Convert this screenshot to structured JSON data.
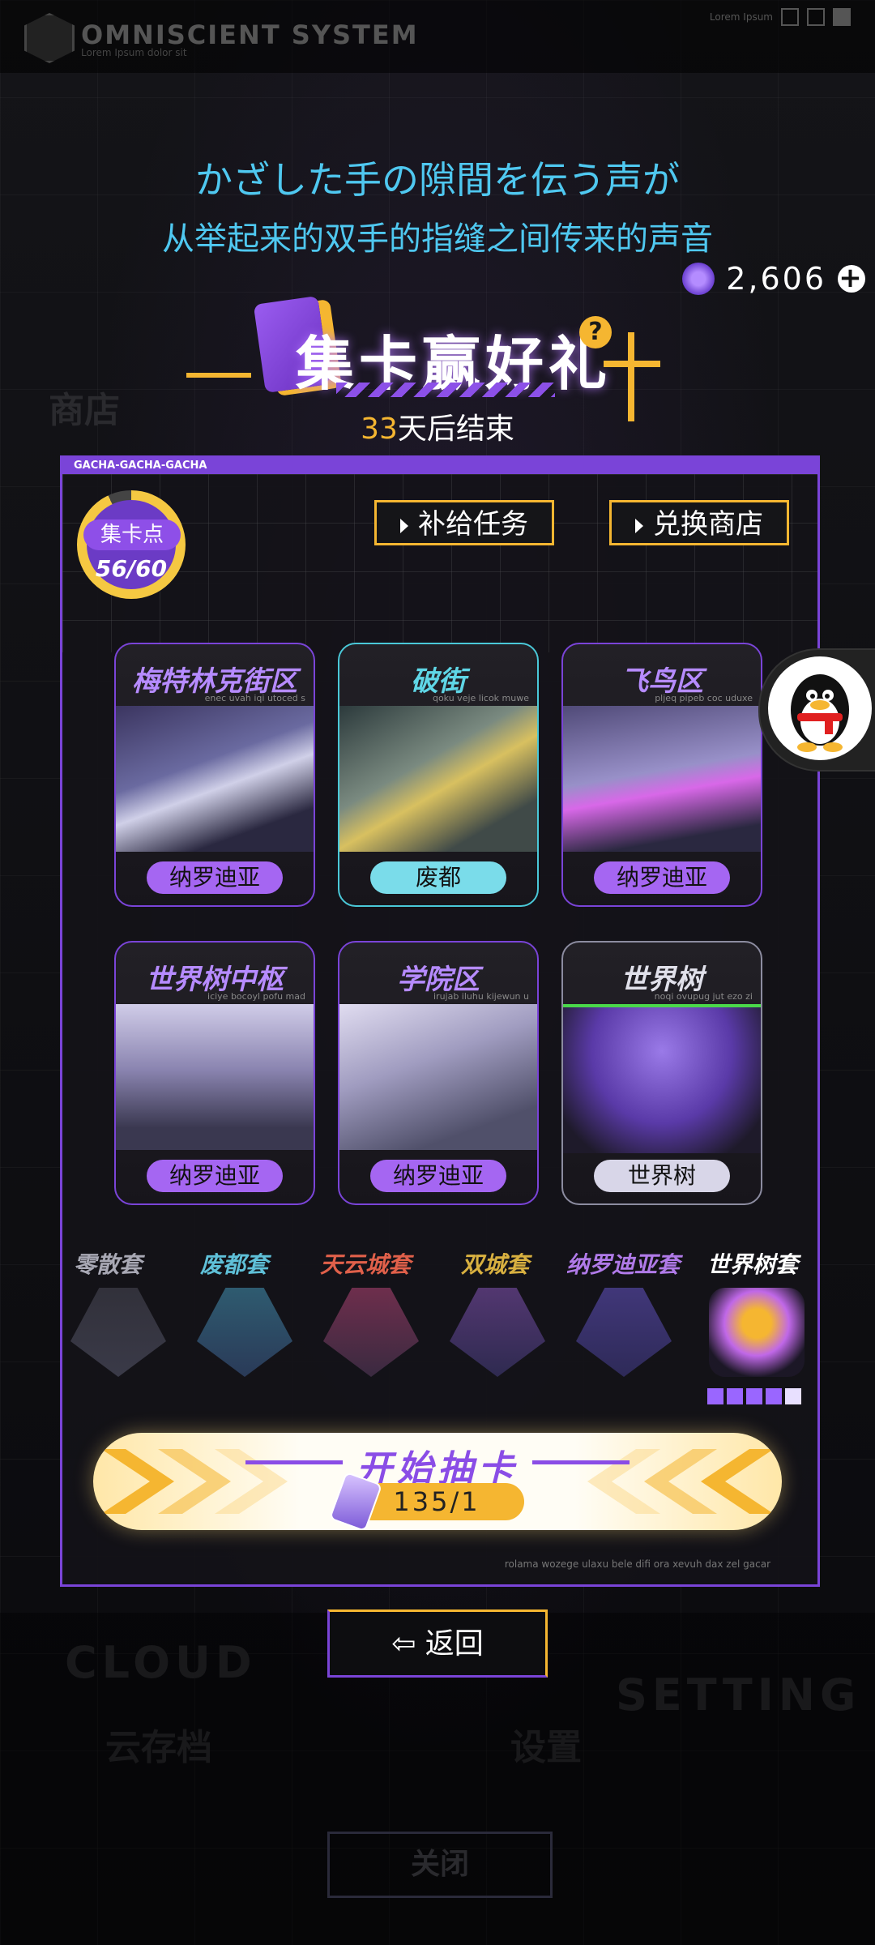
{
  "system": {
    "title": "OMNISCIENT SYSTEM",
    "subtitle": "Lorem Ipsum dolor sit",
    "top_right_text": "Lorem Ipsum"
  },
  "lyrics": {
    "line_jp": "かざした手の隙間を伝う声が",
    "line_cn": "从举起来的双手的指缝之间传来的声音"
  },
  "currency": {
    "amount": "2,606",
    "icon": "crystal-icon",
    "add_icon": "plus-icon"
  },
  "event": {
    "title": "集卡赢好礼",
    "countdown_num": "33",
    "countdown_text": "天后结束",
    "help_icon": "?"
  },
  "panel": {
    "tag": "GACHA-GACHA-GACHA",
    "points_label": "集卡点",
    "points_value": "56/60",
    "points_fraction": 0.933,
    "buttons": {
      "supply": "补给任务",
      "exchange": "兑换商店"
    },
    "cards": [
      {
        "name": "梅特林克街区",
        "sub": "enec uvah iqi utoced s",
        "tag": "纳罗迪亚"
      },
      {
        "name": "破街",
        "sub": "qoku veje licok muwe",
        "tag": "废都"
      },
      {
        "name": "飞鸟区",
        "sub": "pljeq pipeb coc uduxe",
        "tag": "纳罗迪亚"
      },
      {
        "name": "世界树中枢",
        "sub": "iciye bocoyl pofu mad",
        "tag": "纳罗迪亚"
      },
      {
        "name": "学院区",
        "sub": "irujab iluhu kijewun u",
        "tag": "纳罗迪亚"
      },
      {
        "name": "世界树",
        "sub": "noqi ovupug jut ezo zi",
        "tag": "世界树"
      }
    ],
    "sets": [
      {
        "label": "零散套",
        "color": "#a8a8b4"
      },
      {
        "label": "废都套",
        "color": "#5fc0d8"
      },
      {
        "label": "天云城套",
        "color": "#e0604a"
      },
      {
        "label": "双城套",
        "color": "#d8b040"
      },
      {
        "label": "纳罗迪亚套",
        "color": "#b07ae8"
      },
      {
        "label": "世界树套",
        "color": "#ffffff"
      }
    ],
    "draw": {
      "label": "开始抽卡",
      "cost": "135/1"
    },
    "footer": "rolama wozege ulaxu bele difi ora xevuh dax zel gacar"
  },
  "back": {
    "label": "返回"
  }
}
